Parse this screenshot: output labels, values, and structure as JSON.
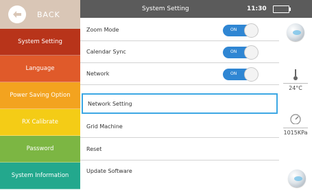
{
  "sidebar": {
    "back_label": "BACK",
    "items": [
      {
        "label": "System Setting",
        "color": "#b8341a"
      },
      {
        "label": "Language",
        "color": "#e05a2a"
      },
      {
        "label": "Power Saving Option",
        "color": "#f3a31f"
      },
      {
        "label": "RX Calibrate",
        "color": "#f4cc16"
      },
      {
        "label": "Password",
        "color": "#7cb643"
      },
      {
        "label": "System Information",
        "color": "#23a88d"
      }
    ]
  },
  "header": {
    "title": "System Setting",
    "time": "11:30",
    "battery_color": "#39d234"
  },
  "settings": {
    "zoom_mode": {
      "label": "Zoom Mode",
      "toggle": "ON"
    },
    "calendar_sync": {
      "label": "Calendar Sync",
      "toggle": "ON"
    },
    "network": {
      "label": "Network",
      "toggle": "ON"
    },
    "network_setting": {
      "label": "Network Setting"
    },
    "grid_machine": {
      "label": "Grid Machine"
    },
    "reset": {
      "label": "Reset"
    },
    "update_software": {
      "label": "Update Software"
    }
  },
  "readings": {
    "temperature": "24°C",
    "pressure": "1015KPa"
  },
  "colors": {
    "accent": "#2f86d3",
    "highlight_border": "#3ca7e4"
  }
}
